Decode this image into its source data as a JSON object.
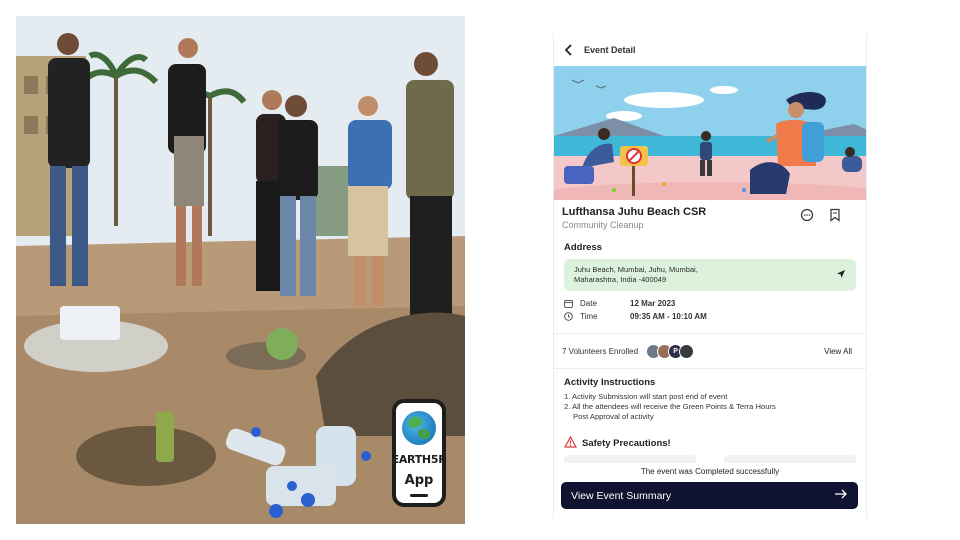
{
  "badge": {
    "brand": "EARTH5R",
    "label": "App"
  },
  "phone": {
    "header": {
      "title": "Event Detail"
    },
    "event": {
      "title": "Lufthansa Juhu Beach CSR",
      "category": "Community Cleanup"
    },
    "address": {
      "label": "Address",
      "line1": "Juhu Beach, Mumbai, Juhu, Mumbai,",
      "line2": "Maharashtra, India -400049"
    },
    "date": {
      "label": "Date",
      "value": "12 Mar 2023"
    },
    "time": {
      "label": "Time",
      "value": "09:35 AM - 10:10 AM"
    },
    "volunteers": {
      "text": "7 Volunteers Enrolled",
      "view_all": "View All",
      "avatars": [
        {
          "initial": "",
          "color": "#6d7a8a"
        },
        {
          "initial": "",
          "color": "#9a6f5a"
        },
        {
          "initial": "P",
          "color": "#2b2f4a"
        },
        {
          "initial": "",
          "color": "#3a3a3a"
        }
      ]
    },
    "activity": {
      "title": "Activity Instructions",
      "item1": "1. Activity Submission will start post end of event",
      "item2a": "2. All the attendees will receive the Green Points & Terra Hours",
      "item2b": "Post Approval of activity"
    },
    "safety": {
      "title": "Safety Precautions!"
    },
    "status": "The event was Completed successfully",
    "cta": {
      "label": "View Event Summary"
    }
  },
  "colors": {
    "cta_bg": "#0f1331",
    "address_bg": "#ddf2dc",
    "warning": "#d93a3a"
  },
  "icons": [
    "back-arrow-icon",
    "chat-icon",
    "bookmark-icon",
    "navigation-arrow-icon",
    "calendar-icon",
    "clock-icon",
    "warning-icon",
    "arrow-right-icon",
    "globe-icon"
  ]
}
